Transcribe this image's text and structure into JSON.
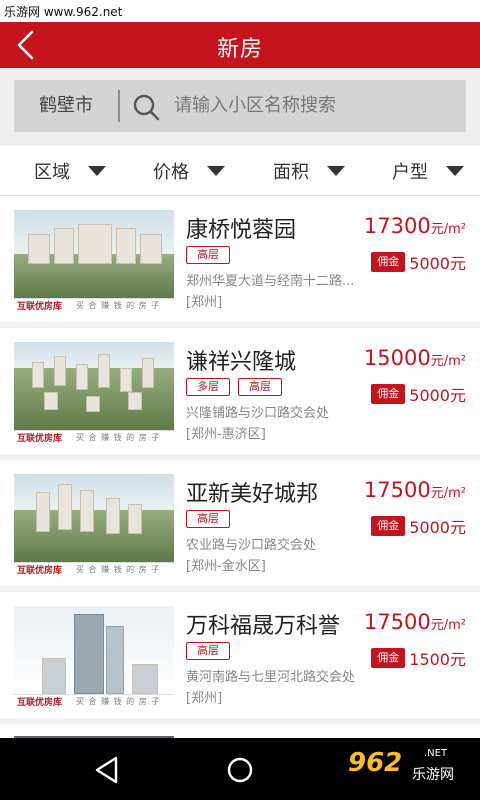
{
  "statusbar": {
    "watermark": "乐游网 www.962.net"
  },
  "header": {
    "title": "新房"
  },
  "search": {
    "city": "鹤壁市",
    "placeholder": "请输入小区名称搜索"
  },
  "filters": [
    {
      "label": "区域"
    },
    {
      "label": "价格"
    },
    {
      "label": "面积"
    },
    {
      "label": "户型"
    }
  ],
  "listings": [
    {
      "name": "康桥悦蓉园",
      "tags": [
        "高层"
      ],
      "address": "郑州华夏大道与经南十二路...",
      "district": "[郑州]",
      "price": "17300",
      "price_unit": "元/m²",
      "commission_label": "佣金",
      "commission": "5000元",
      "thumb_logo": "互联优房库",
      "thumb_slogan": "买 合 赚 钱 的 房 子"
    },
    {
      "name": "谦祥兴隆城",
      "tags": [
        "多层",
        "高层"
      ],
      "address": "兴隆铺路与沙口路交会处",
      "district": "[郑州-惠济区]",
      "price": "15000",
      "price_unit": "元/m²",
      "commission_label": "佣金",
      "commission": "5000元",
      "thumb_logo": "互联优房库",
      "thumb_slogan": "买 合 赚 钱 的 房 子"
    },
    {
      "name": "亚新美好城邦",
      "tags": [
        "高层"
      ],
      "address": "农业路与沙口路交会处",
      "district": "[郑州-金水区]",
      "price": "17500",
      "price_unit": "元/m²",
      "commission_label": "佣金",
      "commission": "5000元",
      "thumb_logo": "互联优房库",
      "thumb_slogan": "买 合 赚 钱 的 房 子"
    },
    {
      "name": "万科福晟万科誉",
      "tags": [
        "高层"
      ],
      "address": "黄河南路与七里河北路交会处",
      "district": "[郑州]",
      "price": "17500",
      "price_unit": "元/m²",
      "commission_label": "佣金",
      "commission": "1500元",
      "thumb_logo": "互联优房库",
      "thumb_slogan": "买 合 赚 钱 的 房 子"
    }
  ],
  "navbar": {
    "watermark_num": "962",
    "watermark_text": "乐游网",
    "watermark_url": ".NET"
  },
  "colors": {
    "accent": "#c6141e",
    "search_bg": "#d4d4d4",
    "list_bg": "#f2f2f2"
  },
  "icons": {
    "back": "chevron-left-icon",
    "search": "search-icon",
    "filter": "triangle-down-icon",
    "nav_back": "nav-back-icon",
    "nav_home": "nav-home-icon"
  }
}
